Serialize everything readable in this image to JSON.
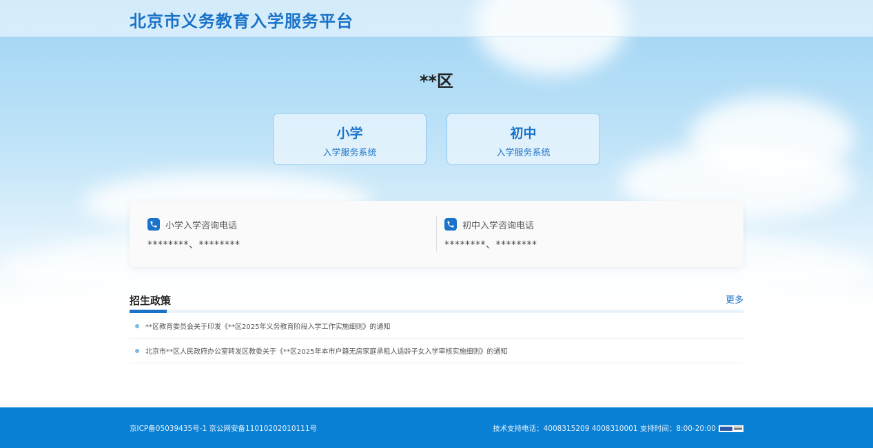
{
  "header": {
    "title": "北京市义务教育入学服务平台"
  },
  "district": {
    "name": "**区"
  },
  "entries": [
    {
      "title": "小学",
      "subtitle": "入学服务系统"
    },
    {
      "title": "初中",
      "subtitle": "入学服务系统"
    }
  ],
  "phones": [
    {
      "label": "小学入学咨询电话",
      "numbers": "********、********",
      "icon": "phone-icon"
    },
    {
      "label": "初中入学咨询电话",
      "numbers": "********、********",
      "icon": "phone-icon"
    }
  ],
  "policy": {
    "title": "招生政策",
    "more": "更多",
    "items": [
      {
        "text": "**区教育委员会关于印发《**区2025年义务教育阶段入学工作实施细则》的通知"
      },
      {
        "text": "北京市**区人民政府办公室转发区教委关于《**区2025年本市户籍无房家庭承租人适龄子女入学审核实施细则》的通知"
      }
    ]
  },
  "footer": {
    "icp": "京ICP备05039435号-1 京公网安备11010202010111号",
    "support": "技术支持电话：4008315209 4008310001 支持时间：8:00-20:00"
  },
  "colors": {
    "accent": "#1a73c8",
    "footer_bg": "#0a80d4"
  }
}
